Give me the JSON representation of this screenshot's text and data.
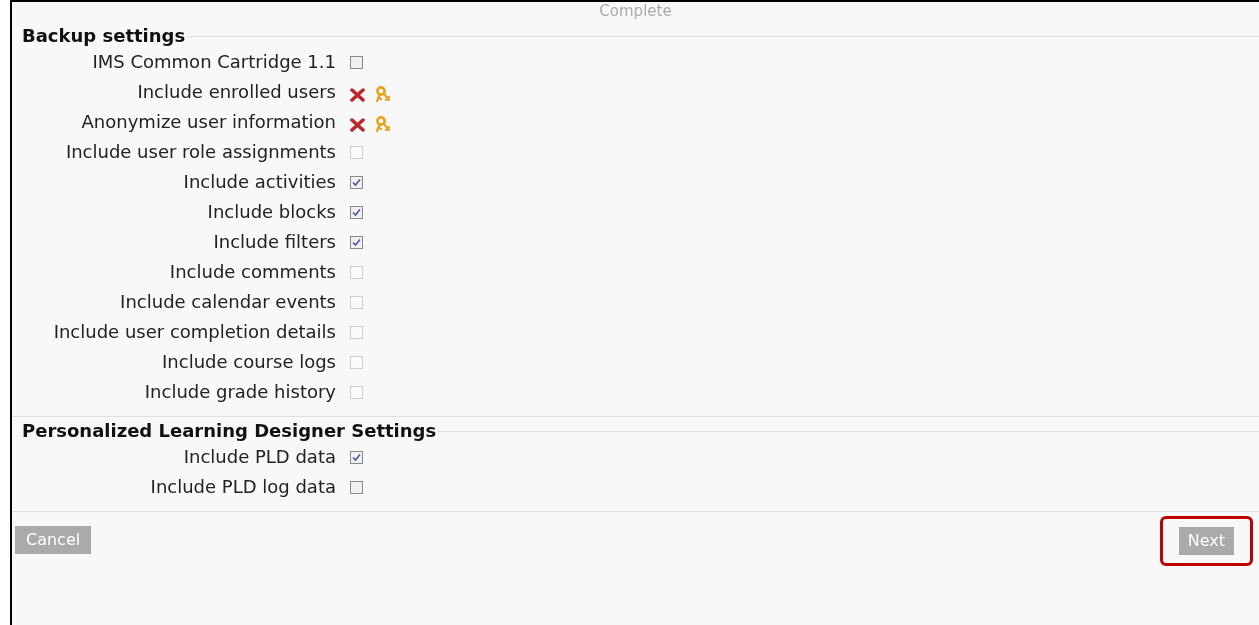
{
  "stage_label": "Complete",
  "sections": [
    {
      "title": "Backup settings",
      "items": [
        {
          "label": "IMS Common Cartridge 1.1",
          "kind": "checkbox",
          "checked": false,
          "disabled": false
        },
        {
          "label": "Include enrolled users",
          "kind": "locked"
        },
        {
          "label": "Anonymize user information",
          "kind": "locked"
        },
        {
          "label": "Include user role assignments",
          "kind": "checkbox",
          "checked": false,
          "disabled": true
        },
        {
          "label": "Include activities",
          "kind": "checkbox",
          "checked": true,
          "disabled": false
        },
        {
          "label": "Include blocks",
          "kind": "checkbox",
          "checked": true,
          "disabled": false
        },
        {
          "label": "Include filters",
          "kind": "checkbox",
          "checked": true,
          "disabled": false
        },
        {
          "label": "Include comments",
          "kind": "checkbox",
          "checked": false,
          "disabled": true
        },
        {
          "label": "Include calendar events",
          "kind": "checkbox",
          "checked": false,
          "disabled": true
        },
        {
          "label": "Include user completion details",
          "kind": "checkbox",
          "checked": false,
          "disabled": true
        },
        {
          "label": "Include course logs",
          "kind": "checkbox",
          "checked": false,
          "disabled": true
        },
        {
          "label": "Include grade history",
          "kind": "checkbox",
          "checked": false,
          "disabled": true
        }
      ]
    },
    {
      "title": "Personalized Learning Designer Settings",
      "items": [
        {
          "label": "Include PLD data",
          "kind": "checkbox",
          "checked": true,
          "disabled": false
        },
        {
          "label": "Include PLD log data",
          "kind": "checkbox",
          "checked": false,
          "disabled": false
        }
      ]
    }
  ],
  "buttons": {
    "cancel": "Cancel",
    "next": "Next",
    "next_highlighted": true
  }
}
